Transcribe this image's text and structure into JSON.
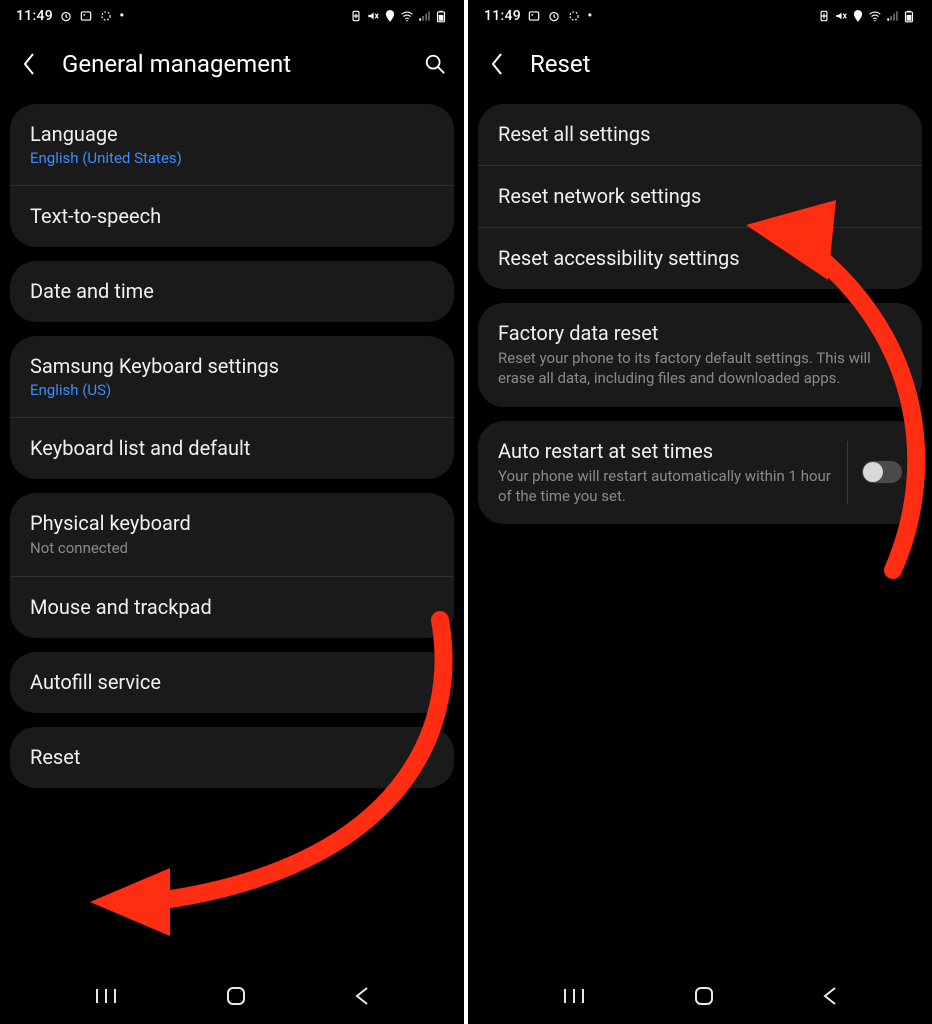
{
  "status": {
    "time": "11:49",
    "icons_left": [
      "alarm-icon",
      "image-icon",
      "loading-icon",
      "dot-icon"
    ],
    "icons_right": [
      "battery-saver-icon",
      "mute-icon",
      "location-icon",
      "wifi-icon",
      "signal-icon",
      "battery-icon"
    ]
  },
  "left": {
    "title": "General management",
    "groups": [
      {
        "rows": [
          {
            "title": "Language",
            "sub_link": "English (United States)"
          },
          {
            "title": "Text-to-speech"
          }
        ]
      },
      {
        "rows": [
          {
            "title": "Date and time"
          }
        ]
      },
      {
        "rows": [
          {
            "title": "Samsung Keyboard settings",
            "sub_link": "English (US)"
          },
          {
            "title": "Keyboard list and default"
          }
        ]
      },
      {
        "rows": [
          {
            "title": "Physical keyboard",
            "sub_muted": "Not connected"
          },
          {
            "title": "Mouse and trackpad"
          }
        ]
      },
      {
        "rows": [
          {
            "title": "Autofill service"
          }
        ]
      },
      {
        "rows": [
          {
            "title": "Reset"
          }
        ]
      }
    ]
  },
  "right": {
    "title": "Reset",
    "groups": [
      {
        "rows": [
          {
            "title": "Reset all settings"
          },
          {
            "title": "Reset network settings"
          },
          {
            "title": "Reset accessibility settings"
          }
        ]
      },
      {
        "rows": [
          {
            "title": "Factory data reset",
            "sub_muted": "Reset your phone to its factory default settings. This will erase all data, including files and downloaded apps."
          }
        ]
      },
      {
        "rows": [
          {
            "title": "Auto restart at set times",
            "sub_muted": "Your phone will restart automatically within 1 hour of the time you set.",
            "toggle": false
          }
        ]
      }
    ]
  },
  "annotations": {
    "arrow_color": "#ff2d12"
  }
}
